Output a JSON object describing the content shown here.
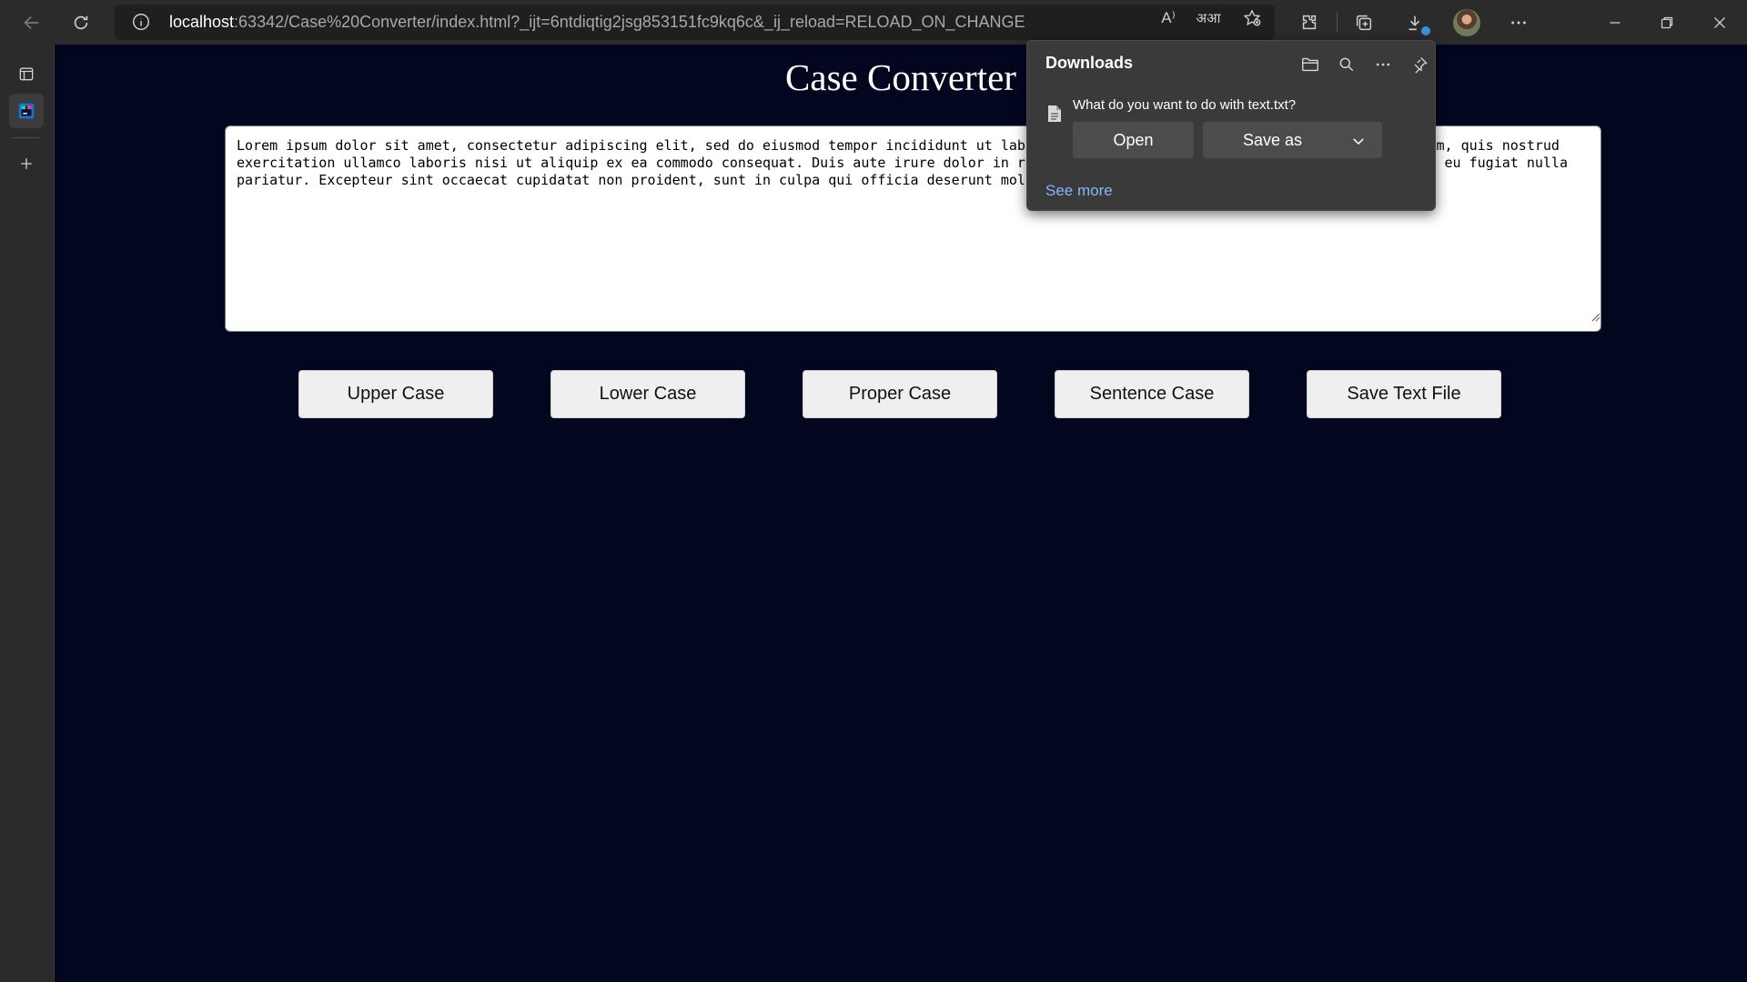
{
  "browser": {
    "url_host": "localhost",
    "url_rest": ":63342/Case%20Converter/index.html?_ijt=6ntdiqtig2jsg853151fc9kq6c&_ij_reload=RELOAD_ON_CHANGE",
    "read_aloud_icon": "A⁾",
    "translate_icon": "अआ"
  },
  "page": {
    "title": "Case Converter",
    "text_value": "Lorem ipsum dolor sit amet, consectetur adipiscing elit, sed do eiusmod tempor incididunt ut labore et dolore magna aliqua. Ut enim ad minim veniam, quis nostrud exercitation ullamco laboris nisi ut aliquip ex ea commodo consequat. Duis aute irure dolor in reprehenderit in voluptate velit esse cillum dolore eu fugiat nulla pariatur. Excepteur sint occaecat cupidatat non proident, sunt in culpa qui officia deserunt mollit anim id est laborum.",
    "buttons": {
      "upper": "Upper Case",
      "lower": "Lower Case",
      "proper": "Proper Case",
      "sentence": "Sentence Case",
      "save": "Save Text File"
    }
  },
  "downloads": {
    "title": "Downloads",
    "question": "What do you want to do with text.txt?",
    "open_label": "Open",
    "save_as_label": "Save as",
    "see_more": "See more"
  },
  "colors": {
    "page_background": "#02061f",
    "browser_chrome": "#2b2b2b",
    "link_blue": "#8ab4f8"
  }
}
